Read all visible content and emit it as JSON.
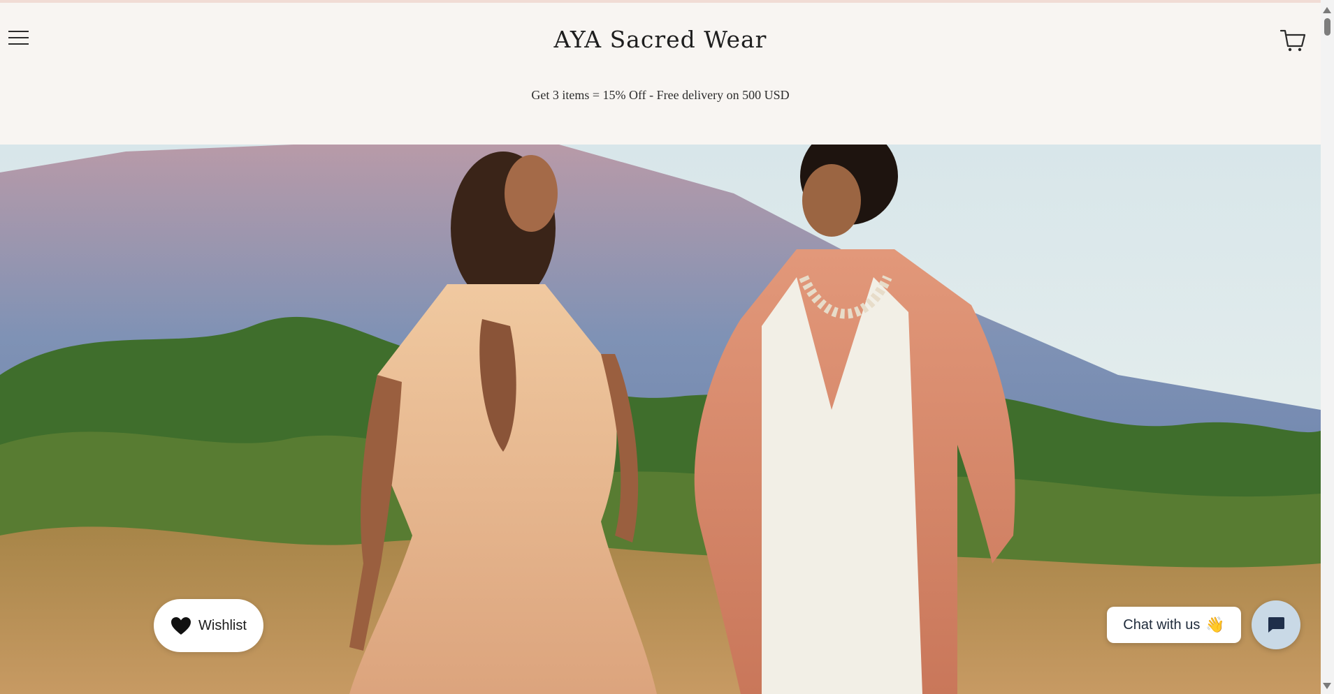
{
  "header": {
    "brand": "AYA Sacred Wear",
    "promo": "Get 3 items = 15% Off - Free delivery on 500 USD",
    "menu_icon": "hamburger-menu-icon",
    "cart_icon": "shopping-cart-icon"
  },
  "hero": {
    "image": "hero-photo"
  },
  "widgets": {
    "wishlist_label": "Wishlist",
    "wishlist_icon": "heart-icon",
    "chat_label": "Chat with us",
    "chat_emoji": "👋",
    "chat_icon": "chat-bubble-icon"
  },
  "colors": {
    "background": "#f8f5f2",
    "text": "#1e1e1e",
    "chat_launcher": "#c9d9e6",
    "chat_icon": "#1f2f4a"
  }
}
